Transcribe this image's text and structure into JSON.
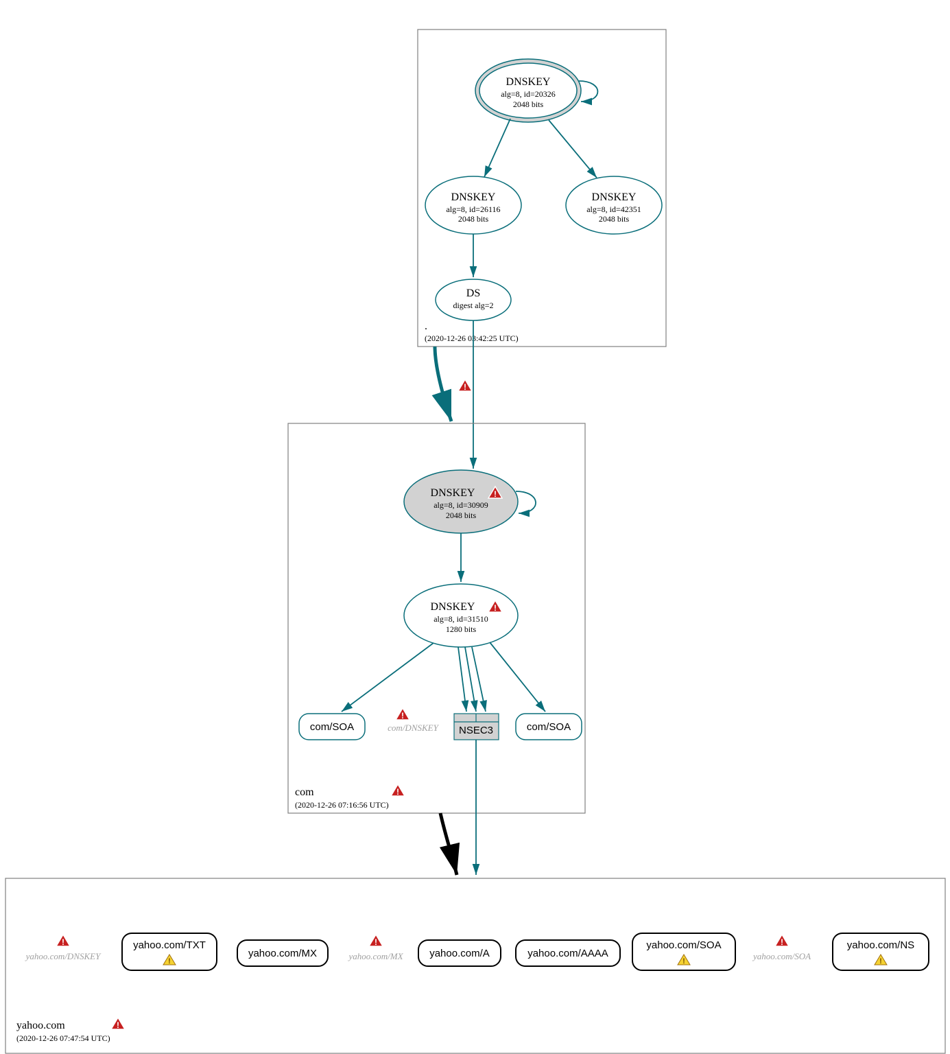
{
  "zones": {
    "root": {
      "label": ".",
      "timestamp": "(2020-12-26 03:42:25 UTC)"
    },
    "com": {
      "label": "com",
      "timestamp": "(2020-12-26 07:16:56 UTC)"
    },
    "yahoo": {
      "label": "yahoo.com",
      "timestamp": "(2020-12-26 07:47:54 UTC)"
    }
  },
  "nodes": {
    "root_ksk": {
      "title": "DNSKEY",
      "line1": "alg=8, id=20326",
      "line2": "2048 bits"
    },
    "root_zsk1": {
      "title": "DNSKEY",
      "line1": "alg=8, id=26116",
      "line2": "2048 bits"
    },
    "root_zsk2": {
      "title": "DNSKEY",
      "line1": "alg=8, id=42351",
      "line2": "2048 bits"
    },
    "root_ds": {
      "title": "DS",
      "line1": "digest alg=2"
    },
    "com_ksk": {
      "title": "DNSKEY",
      "line1": "alg=8, id=30909",
      "line2": "2048 bits"
    },
    "com_zsk": {
      "title": "DNSKEY",
      "line1": "alg=8, id=31510",
      "line2": "1280 bits"
    },
    "com_soa1": "com/SOA",
    "com_dnskey_ghost": "com/DNSKEY",
    "nsec3": "NSEC3",
    "com_soa2": "com/SOA",
    "yahoo_dnskey_ghost": "yahoo.com/DNSKEY",
    "yahoo_txt": "yahoo.com/TXT",
    "yahoo_mx": "yahoo.com/MX",
    "yahoo_mx_ghost": "yahoo.com/MX",
    "yahoo_a": "yahoo.com/A",
    "yahoo_aaaa": "yahoo.com/AAAA",
    "yahoo_soa": "yahoo.com/SOA",
    "yahoo_soa_ghost": "yahoo.com/SOA",
    "yahoo_ns": "yahoo.com/NS"
  },
  "icons": {
    "warn_red": "⚠",
    "warn_yellow": "⚠"
  }
}
